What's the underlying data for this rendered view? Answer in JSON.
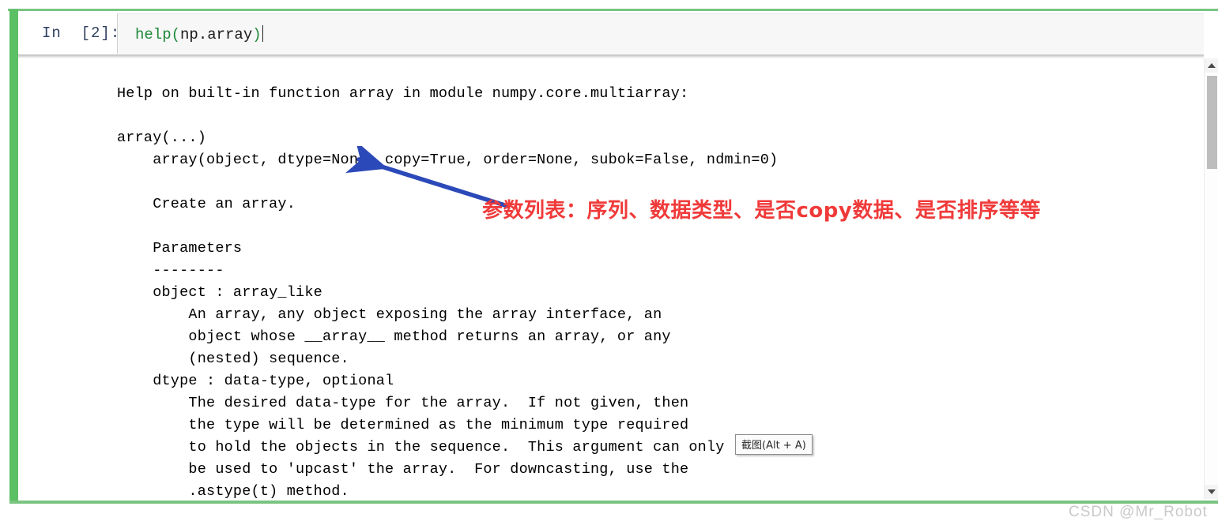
{
  "notebook": {
    "cell": {
      "prompt_label": "In  [2]:",
      "code_tokens": [
        {
          "text": "help",
          "kind": "fn"
        },
        {
          "text": "(",
          "kind": "paren"
        },
        {
          "text": "np.array",
          "kind": "plain"
        },
        {
          "text": ")",
          "kind": "paren"
        }
      ],
      "code_text": "help(np.array)"
    },
    "output": {
      "text": "Help on built-in function array in module numpy.core.multiarray:\n\narray(...)\n    array(object, dtype=None, copy=True, order=None, subok=False, ndmin=0)\n\n    Create an array.\n\n    Parameters\n    --------\n    object : array_like\n        An array, any object exposing the array interface, an\n        object whose __array__ method returns an array, or any\n        (nested) sequence.\n    dtype : data-type, optional\n        The desired data-type for the array.  If not given, then\n        the type will be determined as the minimum type required\n        to hold the objects in the sequence.  This argument can only\n        be used to 'upcast' the array.  For downcasting, use the\n        .astype(t) method.\n    copy : bool, optional"
    },
    "scrollbar": {
      "up_arrow": "scroll-up",
      "down_arrow": "scroll-down"
    }
  },
  "annotations": {
    "arrow_color": "#2b49b8",
    "note_text": "参数列表：序列、数据类型、是否copy数据、是否排序等等",
    "note_color": "#f03a3a"
  },
  "overlays": {
    "snip_tooltip": "截图(Alt + A)",
    "watermark": "CSDN @Mr_Robot"
  },
  "colors": {
    "cell_selected_green": "#5bbf63",
    "rule_green": "#7ac47f",
    "code_string_green": "#1f8a3b",
    "prompt_navy": "#303f60"
  }
}
